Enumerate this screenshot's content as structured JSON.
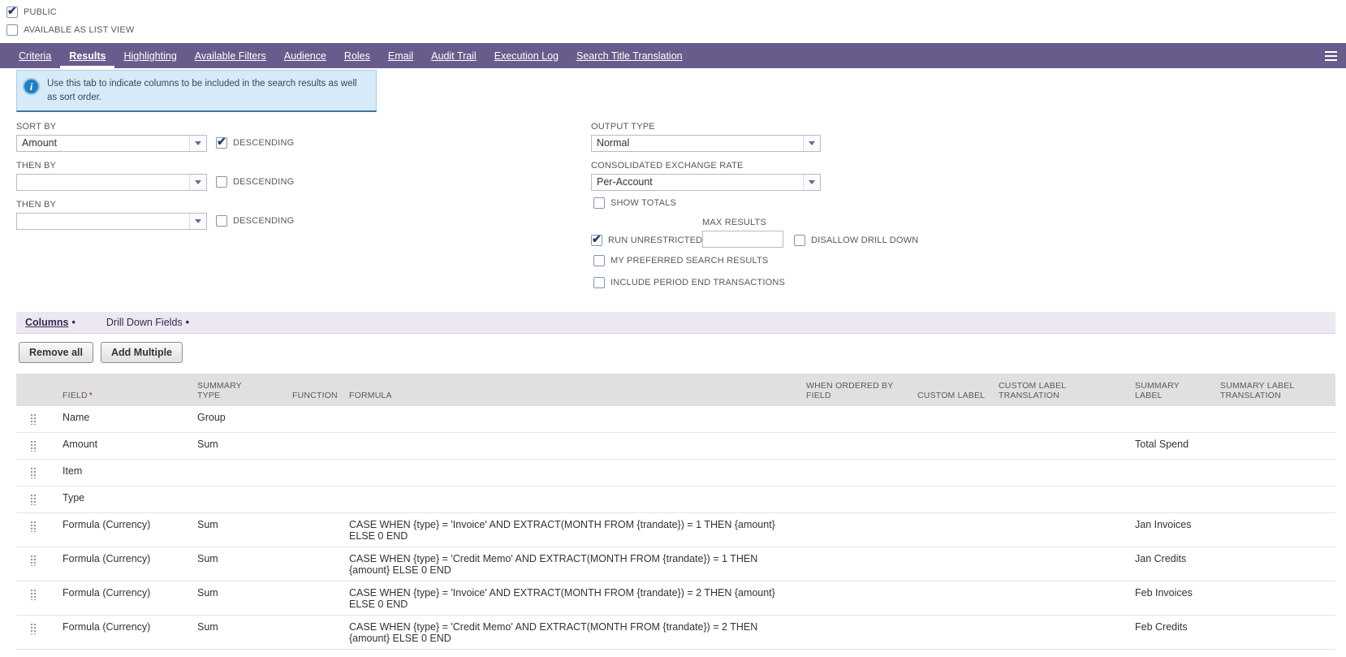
{
  "top": {
    "public_label": "PUBLIC",
    "public_checked": true,
    "list_view_label": "AVAILABLE AS LIST VIEW",
    "list_view_checked": false
  },
  "tabbar": {
    "tabs": [
      {
        "label": "Criteria",
        "active": false
      },
      {
        "label": "Results",
        "active": true
      },
      {
        "label": "Highlighting",
        "active": false
      },
      {
        "label": "Available Filters",
        "active": false
      },
      {
        "label": "Audience",
        "active": false
      },
      {
        "label": "Roles",
        "active": false
      },
      {
        "label": "Email",
        "active": false
      },
      {
        "label": "Audit Trail",
        "active": false
      },
      {
        "label": "Execution Log",
        "active": false
      },
      {
        "label": "Search Title Translation",
        "active": false
      }
    ]
  },
  "info_box": {
    "text": "Use this tab to indicate columns to be included in the search results as well as sort order."
  },
  "form": {
    "sort_by_label": "SORT BY",
    "sort_by_value": "Amount",
    "then_by_1_label": "THEN BY",
    "then_by_1_value": "",
    "then_by_2_label": "THEN BY",
    "then_by_2_value": "",
    "descending_label": "DESCENDING",
    "sort_descending_checked": true,
    "then_1_descending_checked": false,
    "then_2_descending_checked": false,
    "output_type_label": "OUTPUT TYPE",
    "output_type_value": "Normal",
    "consolidated_exchange_rate_label": "CONSOLIDATED EXCHANGE RATE",
    "consolidated_exchange_rate_value": "Per-Account",
    "show_totals_label": "SHOW TOTALS",
    "show_totals_checked": false,
    "max_results_label": "MAX RESULTS",
    "max_results_value": "",
    "run_unrestricted_label": "RUN UNRESTRICTED",
    "run_unrestricted_checked": true,
    "disallow_drill_down_label": "DISALLOW DRILL DOWN",
    "disallow_drill_down_checked": false,
    "my_preferred_label": "MY PREFERRED SEARCH RESULTS",
    "my_preferred_checked": false,
    "include_period_end_label": "INCLUDE PERIOD END TRANSACTIONS",
    "include_period_end_checked": false
  },
  "subtabs": [
    {
      "label": "Columns",
      "dot": "•",
      "active": true
    },
    {
      "label": "Drill Down Fields",
      "dot": "•",
      "active": false
    }
  ],
  "actions": {
    "remove_all": "Remove all",
    "add_multiple": "Add Multiple"
  },
  "columns_table": {
    "headers": {
      "field": "FIELD",
      "required_marker": "*",
      "summary_type": "SUMMARY TYPE",
      "function": "FUNCTION",
      "formula": "FORMULA",
      "when_ordered_by_field": "WHEN ORDERED BY FIELD",
      "custom_label": "CUSTOM LABEL",
      "custom_label_translation": "CUSTOM LABEL TRANSLATION",
      "summary_label": "SUMMARY LABEL",
      "summary_label_translation": "SUMMARY LABEL TRANSLATION"
    },
    "rows": [
      {
        "field": "Name",
        "summary_type": "Group",
        "function": "",
        "formula": "",
        "when_ordered_by_field": "",
        "custom_label": "",
        "custom_label_translation": "",
        "summary_label": "",
        "summary_label_translation": ""
      },
      {
        "field": "Amount",
        "summary_type": "Sum",
        "function": "",
        "formula": "",
        "when_ordered_by_field": "",
        "custom_label": "",
        "custom_label_translation": "",
        "summary_label": "Total Spend",
        "summary_label_translation": ""
      },
      {
        "field": "Item",
        "summary_type": "",
        "function": "",
        "formula": "",
        "when_ordered_by_field": "",
        "custom_label": "",
        "custom_label_translation": "",
        "summary_label": "",
        "summary_label_translation": ""
      },
      {
        "field": "Type",
        "summary_type": "",
        "function": "",
        "formula": "",
        "when_ordered_by_field": "",
        "custom_label": "",
        "custom_label_translation": "",
        "summary_label": "",
        "summary_label_translation": ""
      },
      {
        "field": "Formula (Currency)",
        "summary_type": "Sum",
        "function": "",
        "formula": "CASE WHEN {type} = 'Invoice' AND EXTRACT(MONTH FROM {trandate}) = 1 THEN {amount} ELSE 0 END",
        "when_ordered_by_field": "",
        "custom_label": "",
        "custom_label_translation": "",
        "summary_label": "Jan Invoices",
        "summary_label_translation": ""
      },
      {
        "field": "Formula (Currency)",
        "summary_type": "Sum",
        "function": "",
        "formula": "CASE WHEN {type} = 'Credit Memo' AND EXTRACT(MONTH FROM {trandate}) = 1 THEN {amount} ELSE 0 END",
        "when_ordered_by_field": "",
        "custom_label": "",
        "custom_label_translation": "",
        "summary_label": "Jan Credits",
        "summary_label_translation": ""
      },
      {
        "field": "Formula (Currency)",
        "summary_type": "Sum",
        "function": "",
        "formula": "CASE WHEN {type} = 'Invoice' AND EXTRACT(MONTH FROM {trandate}) = 2 THEN {amount} ELSE 0 END",
        "when_ordered_by_field": "",
        "custom_label": "",
        "custom_label_translation": "",
        "summary_label": "Feb Invoices",
        "summary_label_translation": ""
      },
      {
        "field": "Formula (Currency)",
        "summary_type": "Sum",
        "function": "",
        "formula": "CASE WHEN {type} = 'Credit Memo' AND EXTRACT(MONTH FROM {trandate}) = 2 THEN {amount} ELSE 0 END",
        "when_ordered_by_field": "",
        "custom_label": "",
        "custom_label_translation": "",
        "summary_label": "Feb Credits",
        "summary_label_translation": ""
      }
    ]
  }
}
